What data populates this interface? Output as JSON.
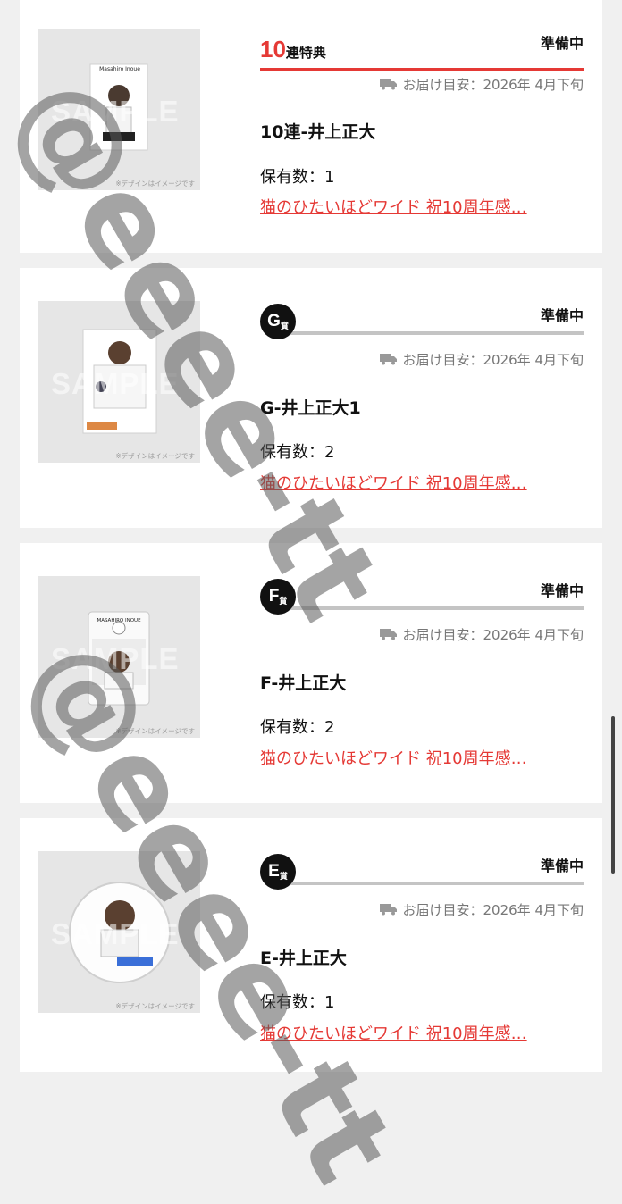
{
  "items": [
    {
      "badge_type": "bonus",
      "badge_number": "10",
      "badge_text": "連特典",
      "status": "準備中",
      "delivery": "お届け目安：2026年 4月下旬",
      "name": "10連-井上正大",
      "holding": "保有数：1",
      "event": "猫のひたいほどワイド 祝10周年感…",
      "thumb_sample": "SAMPLE",
      "thumb_note": "※デザインはイメージです",
      "thumb_caption": "Masahiro Inoue"
    },
    {
      "badge_type": "rank",
      "rank_letter": "G",
      "rank_suffix": "賞",
      "status": "準備中",
      "delivery": "お届け目安：2026年 4月下旬",
      "name": "G-井上正大1",
      "holding": "保有数：2",
      "event": "猫のひたいほどワイド 祝10周年感…",
      "thumb_sample": "SAMPLE",
      "thumb_note": "※デザインはイメージです"
    },
    {
      "badge_type": "rank",
      "rank_letter": "F",
      "rank_suffix": "賞",
      "status": "準備中",
      "delivery": "お届け目安：2026年 4月下旬",
      "name": "F-井上正大",
      "holding": "保有数：2",
      "event": "猫のひたいほどワイド 祝10周年感…",
      "thumb_sample": "SAMPLE",
      "thumb_note": "※デザインはイメージです",
      "thumb_caption": "MASAHIRO INOUE"
    },
    {
      "badge_type": "rank",
      "rank_letter": "E",
      "rank_suffix": "賞",
      "status": "準備中",
      "delivery": "お届け目安：2026年 4月下旬",
      "name": "E-井上正大",
      "holding": "保有数：1",
      "event": "猫のひたいほどワイド 祝10周年感…",
      "thumb_sample": "SAMPLE",
      "thumb_note": "※デザインはイメージです"
    }
  ],
  "watermark": "@eeee-tt",
  "colors": {
    "accent": "#e53935",
    "background": "#f0f0f0",
    "card": "#ffffff"
  },
  "icons": {
    "delivery": "truck-icon"
  }
}
